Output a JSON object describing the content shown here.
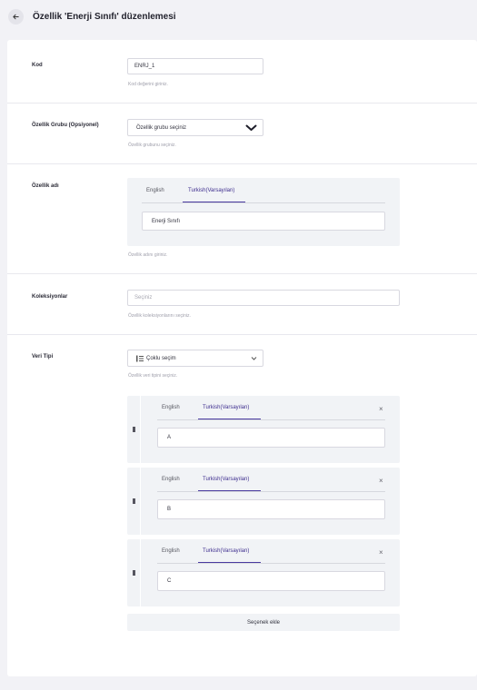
{
  "header": {
    "title": "Özellik 'Enerji Sınıfı' düzenlemesi"
  },
  "form": {
    "code": {
      "label": "Kod",
      "value": "ENRJ_1",
      "help": "Kod değerini giriniz."
    },
    "group": {
      "label": "Özellik Grubu (Opsiyonel)",
      "placeholder": "Özellik grubu seçiniz",
      "help": "Özellik grubunu seçiniz."
    },
    "name": {
      "label": "Özellik adı",
      "tabs": [
        "English",
        "Turkish(Varsayılan)"
      ],
      "value": "Enerji Sınıfı",
      "help": "Özellik adını giriniz."
    },
    "collections": {
      "label": "Koleksiyonlar",
      "placeholder": "Seçiniz",
      "help": "Özellik koleksiyonlarını seçiniz."
    },
    "data_type": {
      "label": "Veri Tipi",
      "value": "Çoklu seçim",
      "help": "Özellik veri tipini seçiniz."
    },
    "options": [
      {
        "tabs": [
          "English",
          "Turkish(Varsayılan)"
        ],
        "value": "A",
        "close": "×"
      },
      {
        "tabs": [
          "English",
          "Turkish(Varsayılan)"
        ],
        "value": "B",
        "close": "×"
      },
      {
        "tabs": [
          "English",
          "Turkish(Varsayılan)"
        ],
        "value": "C",
        "close": "×"
      }
    ],
    "add_option_label": "Seçenek ekle"
  },
  "icons": {
    "back": "arrow-left-icon",
    "select_chevron": "chevron-down-icon",
    "data_type_icon": "list-icon",
    "drag": "drag-handle-icon",
    "remove": "close-icon"
  },
  "colors": {
    "accent": "#4a3aa0",
    "panel": "#f1f3f6",
    "background": "#f2f2f6"
  }
}
